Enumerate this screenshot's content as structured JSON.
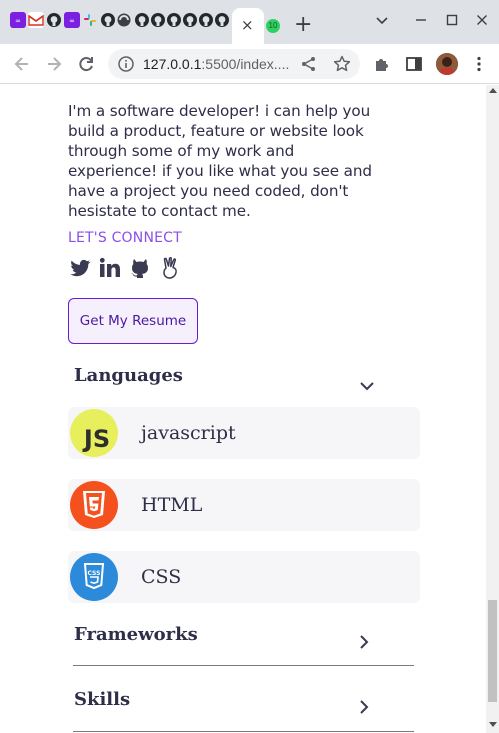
{
  "browser": {
    "active_tab_close": "×",
    "badge_count": "10",
    "new_tab": "+",
    "url_host": "127.0.0.1",
    "url_rest": ":5500/index....",
    "window_controls": {
      "dropdown": "⌄",
      "minimize": "–",
      "maximize": "☐",
      "close": "✕"
    }
  },
  "bio": {
    "text": "I'm a software developer! i can help you build a product, feature or website look through some of my work and experience! if you like what you see and have a project you need coded, don't hesistate to contact me."
  },
  "connect": {
    "label": "LET'S CONNECT",
    "socials": [
      "twitter-icon",
      "linkedin-icon",
      "github-icon",
      "angellist-icon"
    ]
  },
  "resume": {
    "label": "Get My Resume"
  },
  "languages": {
    "title": "Languages",
    "items": [
      {
        "name": "javascript",
        "icon": "js-icon",
        "color": "#e8ef5c"
      },
      {
        "name": "HTML",
        "icon": "html5-icon",
        "color": "#f4511e"
      },
      {
        "name": "CSS",
        "icon": "css3-icon",
        "color": "#2b8ad9"
      }
    ]
  },
  "frameworks": {
    "title": "Frameworks"
  },
  "skills": {
    "title": "Skills"
  },
  "colors": {
    "accent": "#6a1bd6",
    "connect": "#8a4fe8",
    "text": "#2e2e48",
    "card": "#f6f6f8"
  }
}
